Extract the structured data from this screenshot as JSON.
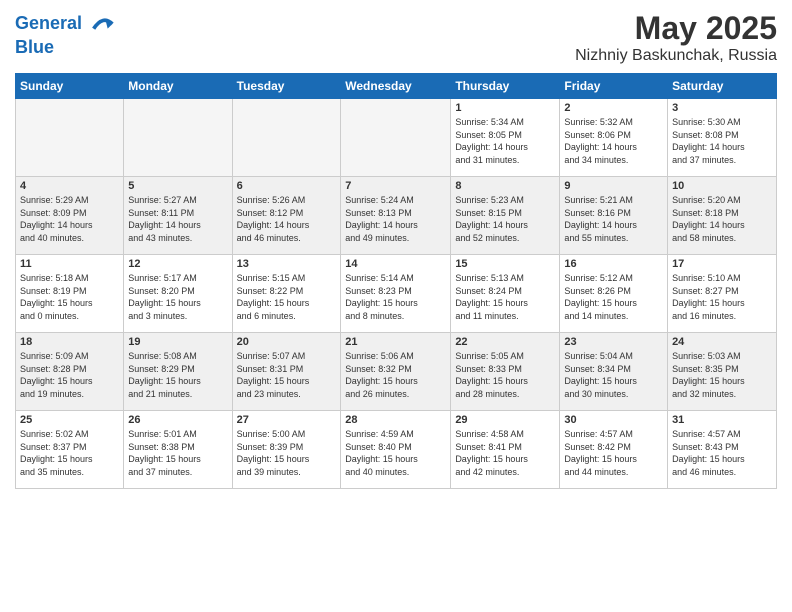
{
  "header": {
    "logo_line1": "General",
    "logo_line2": "Blue",
    "month_year": "May 2025",
    "location": "Nizhniy Baskunchak, Russia"
  },
  "days_of_week": [
    "Sunday",
    "Monday",
    "Tuesday",
    "Wednesday",
    "Thursday",
    "Friday",
    "Saturday"
  ],
  "weeks": [
    [
      {
        "day": "",
        "info": ""
      },
      {
        "day": "",
        "info": ""
      },
      {
        "day": "",
        "info": ""
      },
      {
        "day": "",
        "info": ""
      },
      {
        "day": "1",
        "info": "Sunrise: 5:34 AM\nSunset: 8:05 PM\nDaylight: 14 hours\nand 31 minutes."
      },
      {
        "day": "2",
        "info": "Sunrise: 5:32 AM\nSunset: 8:06 PM\nDaylight: 14 hours\nand 34 minutes."
      },
      {
        "day": "3",
        "info": "Sunrise: 5:30 AM\nSunset: 8:08 PM\nDaylight: 14 hours\nand 37 minutes."
      }
    ],
    [
      {
        "day": "4",
        "info": "Sunrise: 5:29 AM\nSunset: 8:09 PM\nDaylight: 14 hours\nand 40 minutes."
      },
      {
        "day": "5",
        "info": "Sunrise: 5:27 AM\nSunset: 8:11 PM\nDaylight: 14 hours\nand 43 minutes."
      },
      {
        "day": "6",
        "info": "Sunrise: 5:26 AM\nSunset: 8:12 PM\nDaylight: 14 hours\nand 46 minutes."
      },
      {
        "day": "7",
        "info": "Sunrise: 5:24 AM\nSunset: 8:13 PM\nDaylight: 14 hours\nand 49 minutes."
      },
      {
        "day": "8",
        "info": "Sunrise: 5:23 AM\nSunset: 8:15 PM\nDaylight: 14 hours\nand 52 minutes."
      },
      {
        "day": "9",
        "info": "Sunrise: 5:21 AM\nSunset: 8:16 PM\nDaylight: 14 hours\nand 55 minutes."
      },
      {
        "day": "10",
        "info": "Sunrise: 5:20 AM\nSunset: 8:18 PM\nDaylight: 14 hours\nand 58 minutes."
      }
    ],
    [
      {
        "day": "11",
        "info": "Sunrise: 5:18 AM\nSunset: 8:19 PM\nDaylight: 15 hours\nand 0 minutes."
      },
      {
        "day": "12",
        "info": "Sunrise: 5:17 AM\nSunset: 8:20 PM\nDaylight: 15 hours\nand 3 minutes."
      },
      {
        "day": "13",
        "info": "Sunrise: 5:15 AM\nSunset: 8:22 PM\nDaylight: 15 hours\nand 6 minutes."
      },
      {
        "day": "14",
        "info": "Sunrise: 5:14 AM\nSunset: 8:23 PM\nDaylight: 15 hours\nand 8 minutes."
      },
      {
        "day": "15",
        "info": "Sunrise: 5:13 AM\nSunset: 8:24 PM\nDaylight: 15 hours\nand 11 minutes."
      },
      {
        "day": "16",
        "info": "Sunrise: 5:12 AM\nSunset: 8:26 PM\nDaylight: 15 hours\nand 14 minutes."
      },
      {
        "day": "17",
        "info": "Sunrise: 5:10 AM\nSunset: 8:27 PM\nDaylight: 15 hours\nand 16 minutes."
      }
    ],
    [
      {
        "day": "18",
        "info": "Sunrise: 5:09 AM\nSunset: 8:28 PM\nDaylight: 15 hours\nand 19 minutes."
      },
      {
        "day": "19",
        "info": "Sunrise: 5:08 AM\nSunset: 8:29 PM\nDaylight: 15 hours\nand 21 minutes."
      },
      {
        "day": "20",
        "info": "Sunrise: 5:07 AM\nSunset: 8:31 PM\nDaylight: 15 hours\nand 23 minutes."
      },
      {
        "day": "21",
        "info": "Sunrise: 5:06 AM\nSunset: 8:32 PM\nDaylight: 15 hours\nand 26 minutes."
      },
      {
        "day": "22",
        "info": "Sunrise: 5:05 AM\nSunset: 8:33 PM\nDaylight: 15 hours\nand 28 minutes."
      },
      {
        "day": "23",
        "info": "Sunrise: 5:04 AM\nSunset: 8:34 PM\nDaylight: 15 hours\nand 30 minutes."
      },
      {
        "day": "24",
        "info": "Sunrise: 5:03 AM\nSunset: 8:35 PM\nDaylight: 15 hours\nand 32 minutes."
      }
    ],
    [
      {
        "day": "25",
        "info": "Sunrise: 5:02 AM\nSunset: 8:37 PM\nDaylight: 15 hours\nand 35 minutes."
      },
      {
        "day": "26",
        "info": "Sunrise: 5:01 AM\nSunset: 8:38 PM\nDaylight: 15 hours\nand 37 minutes."
      },
      {
        "day": "27",
        "info": "Sunrise: 5:00 AM\nSunset: 8:39 PM\nDaylight: 15 hours\nand 39 minutes."
      },
      {
        "day": "28",
        "info": "Sunrise: 4:59 AM\nSunset: 8:40 PM\nDaylight: 15 hours\nand 40 minutes."
      },
      {
        "day": "29",
        "info": "Sunrise: 4:58 AM\nSunset: 8:41 PM\nDaylight: 15 hours\nand 42 minutes."
      },
      {
        "day": "30",
        "info": "Sunrise: 4:57 AM\nSunset: 8:42 PM\nDaylight: 15 hours\nand 44 minutes."
      },
      {
        "day": "31",
        "info": "Sunrise: 4:57 AM\nSunset: 8:43 PM\nDaylight: 15 hours\nand 46 minutes."
      }
    ]
  ]
}
